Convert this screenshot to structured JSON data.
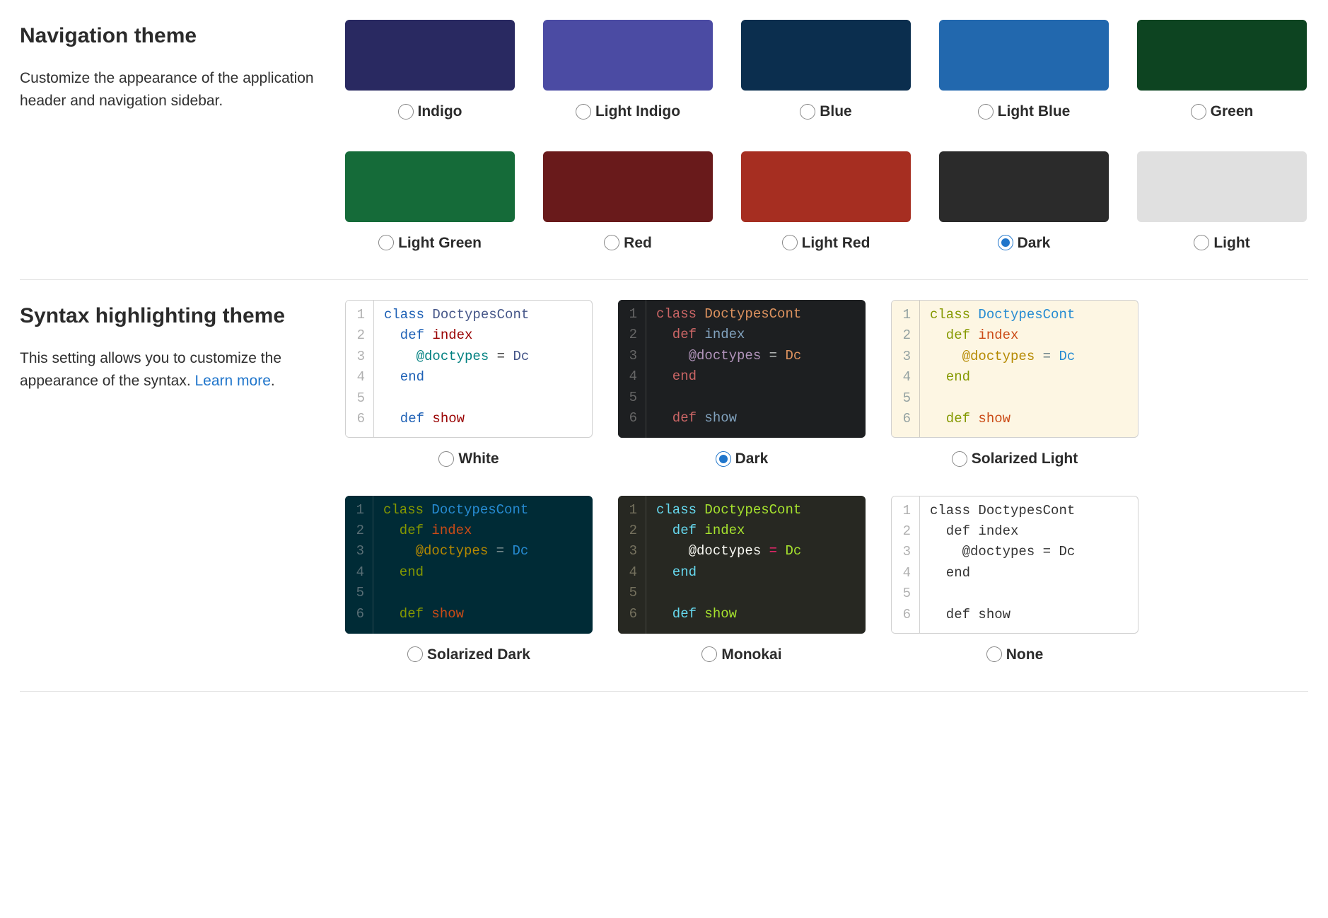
{
  "nav_section": {
    "title": "Navigation theme",
    "description": "Customize the appearance of the application header and navigation sidebar.",
    "options": [
      {
        "label": "Indigo",
        "color": "#292961",
        "selected": false
      },
      {
        "label": "Light Indigo",
        "color": "#4b4ba3",
        "selected": false
      },
      {
        "label": "Blue",
        "color": "#0b2e4e",
        "selected": false
      },
      {
        "label": "Light Blue",
        "color": "#2268ae",
        "selected": false
      },
      {
        "label": "Green",
        "color": "#0d4421",
        "selected": false
      },
      {
        "label": "Light Green",
        "color": "#156b39",
        "selected": false
      },
      {
        "label": "Red",
        "color": "#691a1b",
        "selected": false
      },
      {
        "label": "Light Red",
        "color": "#a62e21",
        "selected": false
      },
      {
        "label": "Dark",
        "color": "#2b2b2b",
        "selected": true
      },
      {
        "label": "Light",
        "color": "#e0e0e0",
        "selected": false
      }
    ]
  },
  "syntax_section": {
    "title": "Syntax highlighting theme",
    "description_prefix": "This setting allows you to customize the appearance of the syntax. ",
    "learn_more": "Learn more",
    "code_sample": {
      "lines": [
        "1",
        "2",
        "3",
        "4",
        "5",
        "6"
      ],
      "tokens": [
        [
          {
            "t": "class ",
            "c": "kw"
          },
          {
            "t": "DoctypesCont",
            "c": "cls"
          }
        ],
        [
          {
            "t": "  def ",
            "c": "kw"
          },
          {
            "t": "index",
            "c": "fn"
          }
        ],
        [
          {
            "t": "    @doctypes",
            "c": "var"
          },
          {
            "t": " = ",
            "c": "op"
          },
          {
            "t": "Dc",
            "c": "cls"
          }
        ],
        [
          {
            "t": "  end",
            "c": "kw"
          }
        ],
        [
          {
            "t": "",
            "c": ""
          }
        ],
        [
          {
            "t": "  def ",
            "c": "kw"
          },
          {
            "t": "show",
            "c": "fn"
          }
        ]
      ]
    },
    "themes": [
      {
        "label": "White",
        "selected": false,
        "bg": "#ffffff",
        "gutter_bg": "#ffffff",
        "gutter_fg": "#b0b0b0",
        "border": true,
        "colors": {
          "kw": "#1d60b5",
          "cls": "#445588",
          "fn": "#990000",
          "var": "#008080",
          "op": "#333333",
          "plain": "#333333"
        }
      },
      {
        "label": "Dark",
        "selected": true,
        "bg": "#1d1f21",
        "gutter_bg": "#1d1f21",
        "gutter_fg": "#666666",
        "border": false,
        "colors": {
          "kw": "#cc6666",
          "cls": "#de935f",
          "fn": "#81a2be",
          "var": "#b294bb",
          "op": "#c5c8c6",
          "plain": "#c5c8c6"
        }
      },
      {
        "label": "Solarized Light",
        "selected": false,
        "bg": "#fdf6e3",
        "gutter_bg": "#fdf6e3",
        "gutter_fg": "#93a1a1",
        "border": true,
        "colors": {
          "kw": "#859900",
          "cls": "#268bd2",
          "fn": "#cb4b16",
          "var": "#b58900",
          "op": "#657b83",
          "plain": "#657b83"
        }
      },
      {
        "label": "Solarized Dark",
        "selected": false,
        "bg": "#002b36",
        "gutter_bg": "#002b36",
        "gutter_fg": "#586e75",
        "border": false,
        "colors": {
          "kw": "#859900",
          "cls": "#268bd2",
          "fn": "#cb4b16",
          "var": "#b58900",
          "op": "#839496",
          "plain": "#839496"
        }
      },
      {
        "label": "Monokai",
        "selected": false,
        "bg": "#272822",
        "gutter_bg": "#272822",
        "gutter_fg": "#75715e",
        "border": false,
        "colors": {
          "kw": "#66d9ef",
          "cls": "#a6e22e",
          "fn": "#a6e22e",
          "var": "#f8f8f2",
          "op": "#f92672",
          "plain": "#f8f8f2"
        }
      },
      {
        "label": "None",
        "selected": false,
        "bg": "#ffffff",
        "gutter_bg": "#ffffff",
        "gutter_fg": "#b0b0b0",
        "border": true,
        "colors": {
          "kw": "#333333",
          "cls": "#333333",
          "fn": "#333333",
          "var": "#333333",
          "op": "#333333",
          "plain": "#333333"
        }
      }
    ]
  }
}
